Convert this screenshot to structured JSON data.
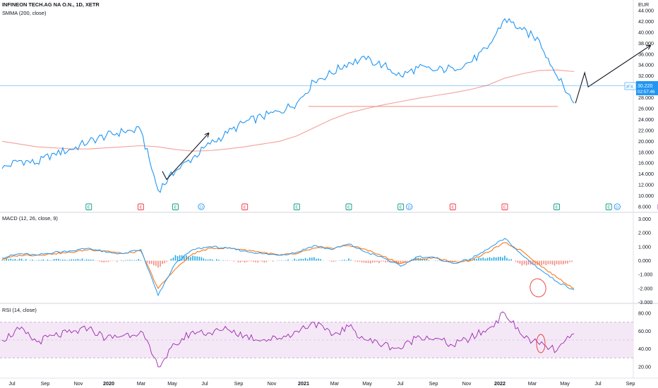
{
  "header": {
    "title": "INFINEON TECH.AG NA O.N., 1D, XETR",
    "indicator": "SMMA (200, close)",
    "currency": "EUR"
  },
  "price_badge": {
    "symbol": "IFX",
    "price": "30.220",
    "countdown": "02:57:46"
  },
  "panes": {
    "macd_label": "MACD (12, 26, close, 9)",
    "rsi_label": "RSI (14, close)"
  },
  "colors": {
    "price": "#2196f3",
    "smma": "#f4a09a",
    "hline": "#f28b82",
    "macd": "#2196f3",
    "signal": "#ff6d00",
    "hist_pos": "#26a9e0",
    "hist_neg": "#f28b82",
    "rsi": "#9c27b0",
    "rsi_band": "#f3e5f5",
    "annotation": "#131722",
    "circle": "#e53935",
    "grid": "#e6e6e6",
    "axis_text": "#131722"
  },
  "time_axis": [
    "Jul",
    "Sep",
    "Nov",
    "2020",
    "Mar",
    "May",
    "Jul",
    "Sep",
    "Nov",
    "2021",
    "Mar",
    "May",
    "Jul",
    "Sep",
    "Nov",
    "2022",
    "Mar",
    "May",
    "Jul",
    "Sep"
  ],
  "events": [
    {
      "label": "E",
      "kind": "earnings",
      "date": "2019-11"
    },
    {
      "label": "E",
      "kind": "earnings-red",
      "date": "2020-02"
    },
    {
      "label": "E",
      "kind": "earnings",
      "date": "2020-04"
    },
    {
      "label": "D",
      "kind": "dividend",
      "date": "2020-05"
    },
    {
      "label": "E",
      "kind": "earnings-red",
      "date": "2020-08"
    },
    {
      "label": "E",
      "kind": "earnings",
      "date": "2020-11"
    },
    {
      "label": "E",
      "kind": "earnings",
      "date": "2021-02"
    },
    {
      "label": "E",
      "kind": "earnings",
      "date": "2021-05"
    },
    {
      "label": "D",
      "kind": "dividend",
      "date": "2021-05"
    },
    {
      "label": "E",
      "kind": "earnings-red",
      "date": "2021-08"
    },
    {
      "label": "E",
      "kind": "earnings-red",
      "date": "2021-11"
    },
    {
      "label": "E",
      "kind": "earnings",
      "date": "2022-02"
    },
    {
      "label": "E",
      "kind": "earnings",
      "date": "2022-05"
    },
    {
      "label": "D",
      "kind": "dividend",
      "date": "2022-05"
    },
    {
      "label": "E",
      "kind": "earnings-future",
      "date": "2022-08"
    }
  ],
  "chart_data": [
    {
      "type": "line",
      "title": "INFINEON TECH.AG NA O.N., 1D, XETR",
      "y_unit": "EUR",
      "ylim": [
        8.0,
        44.0
      ],
      "y_ticks": [
        "44.000",
        "42.000",
        "40.000",
        "38.000",
        "36.000",
        "34.000",
        "32.000",
        "30.000",
        "28.000",
        "26.000",
        "24.000",
        "22.000",
        "20.000",
        "18.000",
        "16.000",
        "14.000",
        "12.000",
        "10.000",
        "8.000"
      ],
      "grid": false,
      "x": [
        "2019-06",
        "2019-07",
        "2019-08",
        "2019-09",
        "2019-10",
        "2019-11",
        "2019-12",
        "2020-01",
        "2020-02",
        "2020-03",
        "2020-04",
        "2020-05",
        "2020-06",
        "2020-07",
        "2020-08",
        "2020-09",
        "2020-10",
        "2020-11",
        "2020-12",
        "2021-01",
        "2021-02",
        "2021-03",
        "2021-04",
        "2021-05",
        "2021-06",
        "2021-07",
        "2021-08",
        "2021-09",
        "2021-10",
        "2021-11",
        "2021-12",
        "2022-01",
        "2022-02",
        "2022-03"
      ],
      "series": [
        {
          "name": "IFX",
          "values": [
            15.0,
            16.5,
            16.0,
            17.8,
            18.5,
            20.0,
            21.0,
            21.8,
            22.0,
            11.0,
            14.5,
            17.0,
            19.5,
            21.5,
            23.5,
            24.5,
            25.5,
            27.0,
            31.0,
            32.5,
            34.5,
            35.0,
            34.0,
            32.0,
            33.5,
            33.0,
            33.5,
            34.5,
            37.0,
            42.5,
            40.5,
            38.5,
            32.0,
            27.0
          ]
        },
        {
          "name": "SMMA (200, close)",
          "values": [
            20.0,
            19.5,
            19.0,
            18.8,
            18.6,
            18.6,
            18.8,
            19.0,
            19.2,
            19.0,
            18.5,
            18.2,
            18.3,
            18.6,
            19.0,
            19.5,
            20.0,
            21.0,
            22.5,
            24.0,
            25.2,
            26.0,
            26.7,
            27.3,
            27.9,
            28.4,
            28.9,
            29.5,
            30.3,
            31.6,
            32.4,
            33.0,
            33.1,
            32.8
          ]
        }
      ],
      "last_price": 30.22,
      "horizontal_line": 26.4,
      "annotations": [
        {
          "type": "arrow",
          "from": [
            "2020-03",
            13.0
          ],
          "to": [
            "2020-06",
            21.5
          ]
        },
        {
          "type": "arrow-path",
          "points": [
            [
              "2022-03",
              27.0
            ],
            [
              "2022-03",
              32.5
            ],
            [
              "2022-04",
              30.0
            ],
            [
              "2022-07",
              37.5
            ]
          ]
        }
      ]
    },
    {
      "type": "line",
      "title": "MACD (12, 26, close, 9)",
      "ylim": [
        -3.0,
        3.0
      ],
      "y_ticks": [
        "3.000",
        "2.000",
        "1.000",
        "0.000",
        "-1.000",
        "-2.000",
        "-3.000"
      ],
      "series": [
        {
          "name": "MACD",
          "values": [
            0.2,
            0.5,
            0.4,
            0.6,
            0.7,
            0.9,
            0.6,
            0.5,
            0.8,
            -2.5,
            -0.2,
            0.8,
            1.0,
            0.9,
            0.7,
            0.5,
            0.4,
            0.6,
            1.1,
            0.8,
            1.2,
            0.6,
            0.2,
            -0.4,
            0.3,
            0.2,
            -0.2,
            0.1,
            0.8,
            1.6,
            0.4,
            -0.6,
            -1.5,
            -2.1
          ]
        },
        {
          "name": "Signal",
          "values": [
            0.1,
            0.4,
            0.4,
            0.5,
            0.6,
            0.8,
            0.7,
            0.5,
            0.7,
            -2.0,
            -0.6,
            0.5,
            0.9,
            0.9,
            0.8,
            0.6,
            0.4,
            0.5,
            0.9,
            0.9,
            1.1,
            0.8,
            0.3,
            -0.2,
            0.1,
            0.2,
            -0.1,
            0.0,
            0.6,
            1.3,
            0.7,
            -0.3,
            -1.2,
            -2.0
          ]
        }
      ]
    },
    {
      "type": "line",
      "title": "RSI (14, close)",
      "ylim": [
        20.0,
        80.0
      ],
      "y_ticks": [
        "80.00",
        "60.00",
        "40.00",
        "20.00"
      ],
      "band": [
        30,
        70
      ],
      "series": [
        {
          "name": "RSI",
          "values": [
            50,
            62,
            48,
            55,
            58,
            63,
            52,
            55,
            60,
            20,
            45,
            60,
            58,
            62,
            55,
            50,
            52,
            60,
            70,
            55,
            65,
            50,
            45,
            40,
            55,
            52,
            44,
            52,
            62,
            80,
            55,
            45,
            38,
            57
          ]
        }
      ]
    }
  ]
}
